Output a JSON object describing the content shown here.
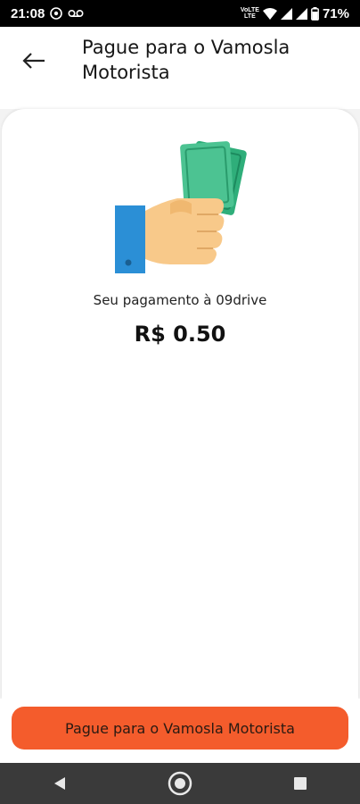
{
  "status_bar": {
    "time": "21:08",
    "battery": "71%",
    "icons": [
      "cast-icon",
      "voicemail-icon",
      "volte-icon",
      "wifi-icon",
      "signal-icon",
      "signal-icon",
      "battery-icon"
    ],
    "volte_text_1": "VoLTE",
    "volte_text_2": "LTE"
  },
  "header": {
    "title": "Pague para o Vamosla Motorista",
    "back_icon": "arrow-left-icon"
  },
  "payment": {
    "label": "Seu pagamento à 09drive",
    "amount": "R$ 0.50",
    "illustration": "hand-with-money-icon"
  },
  "footer": {
    "pay_button_label": "Pague para o Vamosla Motorista",
    "accent_color": "#f45c2c"
  },
  "nav": {
    "back_icon": "nav-back-icon",
    "home_icon": "nav-home-icon",
    "recents_icon": "nav-recents-icon"
  }
}
